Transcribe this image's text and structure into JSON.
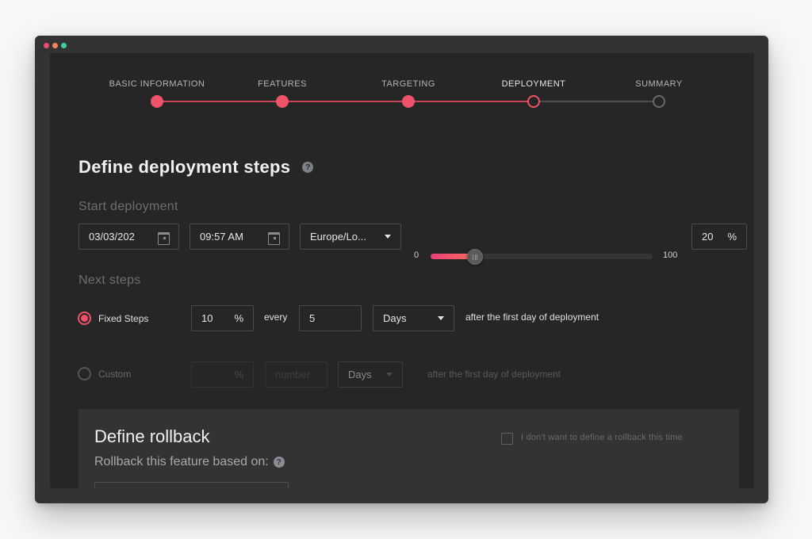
{
  "window": {
    "controls": [
      {
        "name": "close",
        "color": "#ec4c6f"
      },
      {
        "name": "minimize",
        "color": "#f0845a"
      },
      {
        "name": "maximize",
        "color": "#3fcfa4"
      }
    ]
  },
  "stepper": {
    "steps": [
      {
        "label": "BASIC INFORMATION",
        "state": "done"
      },
      {
        "label": "FEATURES",
        "state": "done"
      },
      {
        "label": "TARGETING",
        "state": "done"
      },
      {
        "label": "DEPLOYMENT",
        "state": "current"
      },
      {
        "label": "SUMMARY",
        "state": "todo"
      }
    ],
    "accent": "#ef5369"
  },
  "page": {
    "title": "Define deployment steps",
    "help_icon": "?"
  },
  "start": {
    "label": "Start deployment",
    "date": "03/03/202",
    "time": "09:57 AM",
    "timezone": "Europe/Lo...",
    "slider_min": "0",
    "slider_max": "100",
    "slider_value": 20,
    "percent_value": "20",
    "percent_symbol": "%"
  },
  "next": {
    "label": "Next steps",
    "fixed": {
      "label": "Fixed Steps",
      "selected": true,
      "percent": "10",
      "percent_symbol": "%",
      "every_label": "every",
      "interval": "5",
      "unit": "Days",
      "suffix": "after the first day of deployment"
    },
    "custom": {
      "label": "Custom",
      "selected": false,
      "percent": "",
      "percent_symbol": "%",
      "number_placeholder": "number",
      "unit": "Days",
      "suffix": "after the first day of deployment"
    }
  },
  "rollback": {
    "title": "Define rollback",
    "subtitle": "Rollback this feature based on:",
    "help_icon": "?",
    "skip_label": "I don't want to define a rollback this time",
    "skip_checked": false
  }
}
